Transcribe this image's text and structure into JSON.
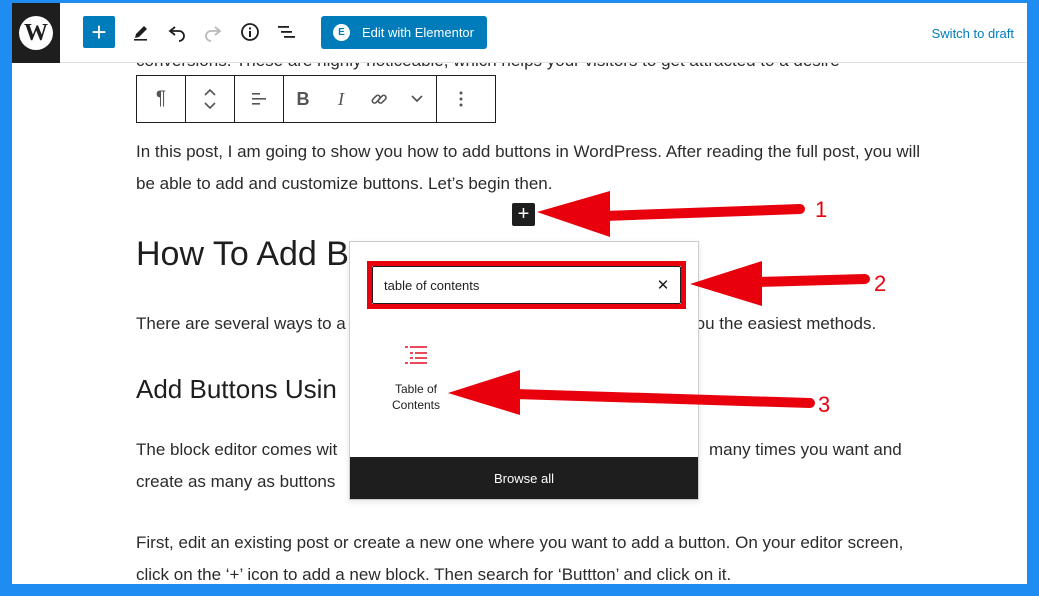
{
  "toolbar": {
    "elementor_label": "Edit with Elementor",
    "switch_draft": "Switch to draft"
  },
  "content": {
    "para_cut": "conversions. These are highly noticeable, which helps your visitors to get attracted to a desire",
    "para1": "In this post, I am going to show you how to add buttons in WordPress. After reading the full post, you will be able to add and customize buttons. Let’s begin then.",
    "heading_h2": "How To Add B",
    "para2_left": "There are several ways to a",
    "para2_right": "g you the easiest methods.",
    "heading_h3": "Add Buttons Usin",
    "para3_line1_left": "The block editor comes wit",
    "para3_line1_right": "many times you want and",
    "para3_line2_left": "create as many as buttons",
    "para4": "First, edit an existing post or create a new one where you want to add a button. On your editor screen, click on the ‘+’ icon to add a new block. Then search for ‘Buttton’ and click on it."
  },
  "inserter": {
    "search_value": "table of contents",
    "result_label": "Table of Contents",
    "browse_all": "Browse all"
  },
  "annotations": {
    "callouts": [
      "1",
      "2",
      "3"
    ],
    "arrow_color": "#e8000c"
  },
  "colors": {
    "accent": "#007cba",
    "frame": "#1e8cf0",
    "annotation": "#e8000c"
  }
}
